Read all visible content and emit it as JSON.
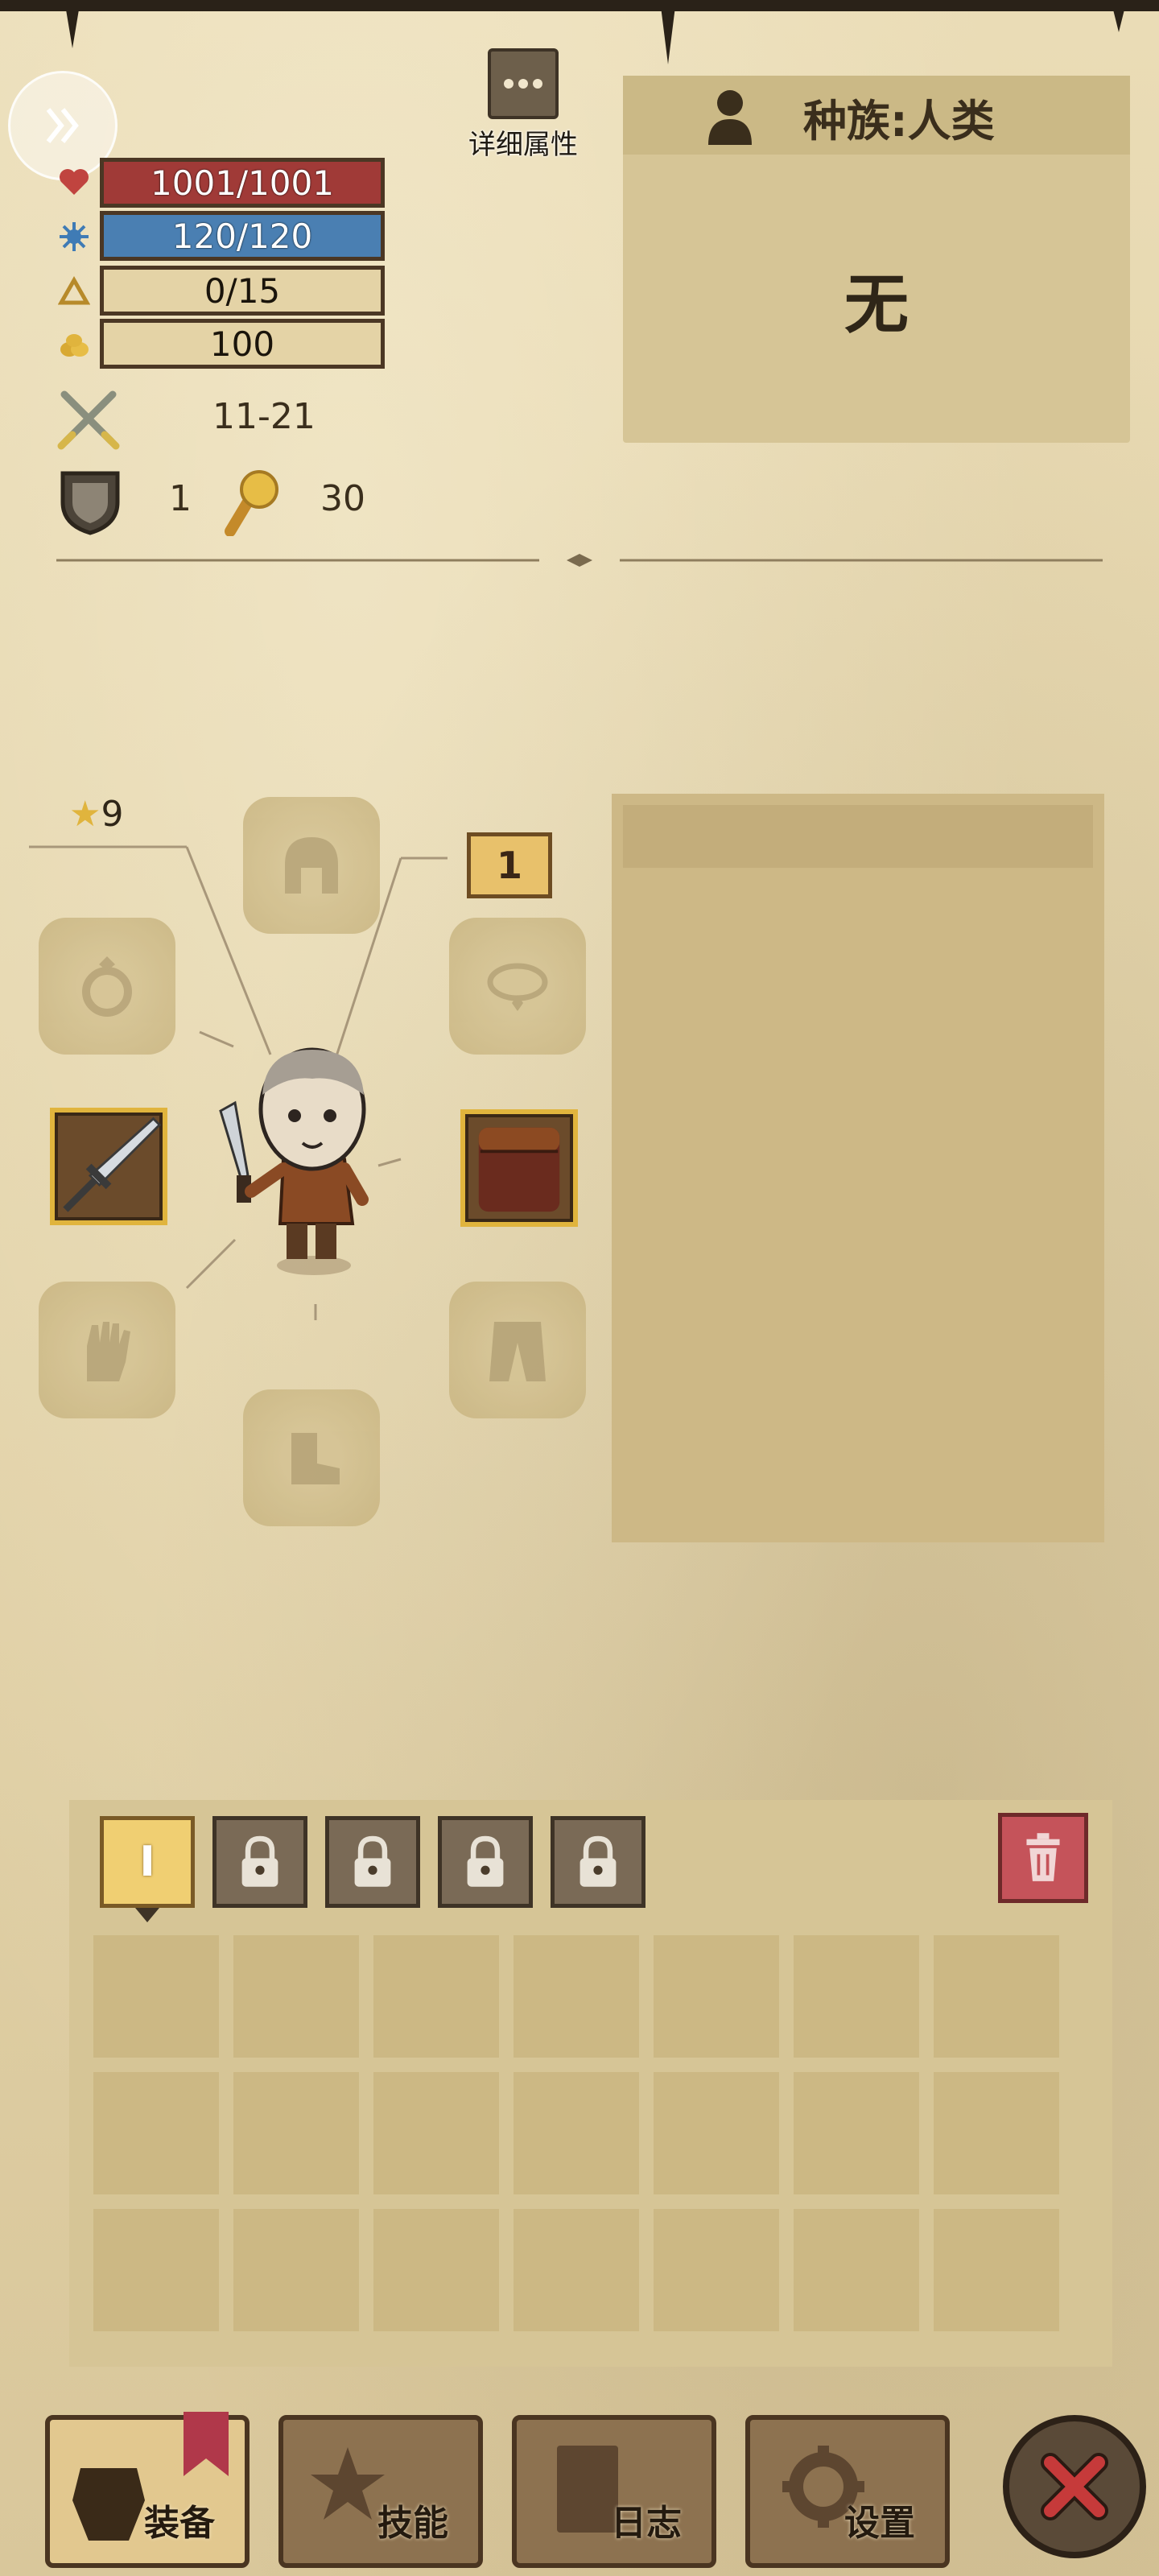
{
  "header": {
    "detail_label": "详细属性"
  },
  "race": {
    "label": "种族:人类",
    "value": "无"
  },
  "stats": {
    "hp": "1001/1001",
    "mp": "120/120",
    "xp": "0/15",
    "gold": "100",
    "attack": "11-21",
    "defense": "1",
    "luck": "30"
  },
  "equipment": {
    "star_level": "9",
    "item_level": "1"
  },
  "inventory": {
    "active_tab": "I"
  },
  "nav": {
    "equip": "装备",
    "skills": "技能",
    "log": "日志",
    "settings": "设置"
  },
  "colors": {
    "hp": "#a03a37",
    "mp": "#4a7fb2",
    "accent": "#e0b43d",
    "close": "#c63a3a"
  }
}
